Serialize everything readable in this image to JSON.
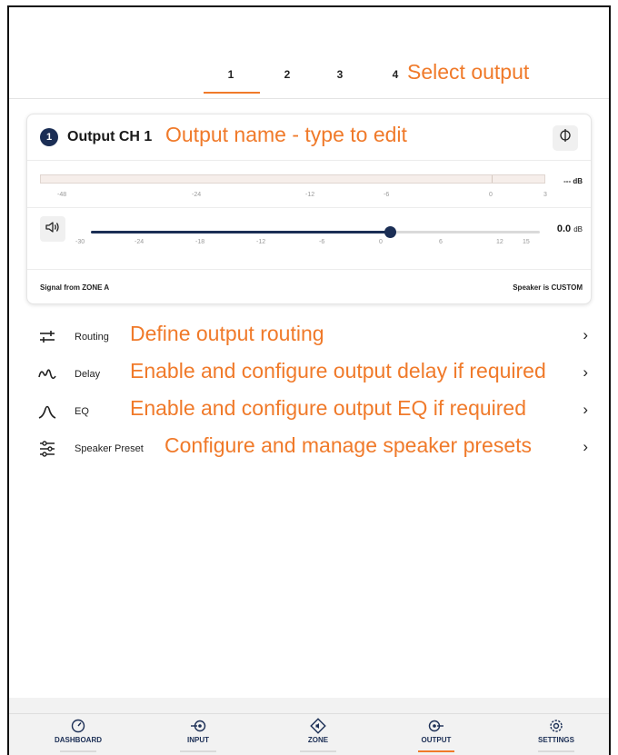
{
  "tabs": [
    {
      "label": "1",
      "active": true
    },
    {
      "label": "2",
      "active": false
    },
    {
      "label": "3",
      "active": false
    },
    {
      "label": "4",
      "active": false
    }
  ],
  "annotations": {
    "select_output": "Select output",
    "output_name": "Output name - type to edit",
    "routing": "Define output routing",
    "delay": "Enable and configure output delay if required",
    "eq": "Enable and configure output EQ if required",
    "speaker_preset": "Configure and manage speaker presets"
  },
  "channel": {
    "number": "1",
    "name": "Output CH 1",
    "phase_icon": "phase-invert-icon",
    "meter": {
      "ticks": [
        "-48",
        "-24",
        "-12",
        "-6",
        "0",
        "3"
      ],
      "readout": "--- dB"
    },
    "gain": {
      "ticks": [
        "-30",
        "-24",
        "-18",
        "-12",
        "-6",
        "0",
        "6",
        "12",
        "15"
      ],
      "value": "0.0",
      "unit": "dB",
      "slider_level": 0
    },
    "signal_from": "Signal from ZONE A",
    "speaker_status": "Speaker is CUSTOM"
  },
  "menu": [
    {
      "label": "Routing",
      "icon": "routing-icon"
    },
    {
      "label": "Delay",
      "icon": "delay-icon"
    },
    {
      "label": "EQ",
      "icon": "eq-icon"
    },
    {
      "label": "Speaker Preset",
      "icon": "speaker-preset-icon"
    }
  ],
  "nav": [
    {
      "label": "DASHBOARD",
      "icon": "gauge-icon",
      "active": false
    },
    {
      "label": "INPUT",
      "icon": "input-icon",
      "active": false
    },
    {
      "label": "ZONE",
      "icon": "zone-icon",
      "active": false
    },
    {
      "label": "OUTPUT",
      "icon": "output-icon",
      "active": true
    },
    {
      "label": "SETTINGS",
      "icon": "gear-icon",
      "active": false
    }
  ],
  "colors": {
    "accent": "#f07a2a",
    "navy": "#1b2e55"
  }
}
